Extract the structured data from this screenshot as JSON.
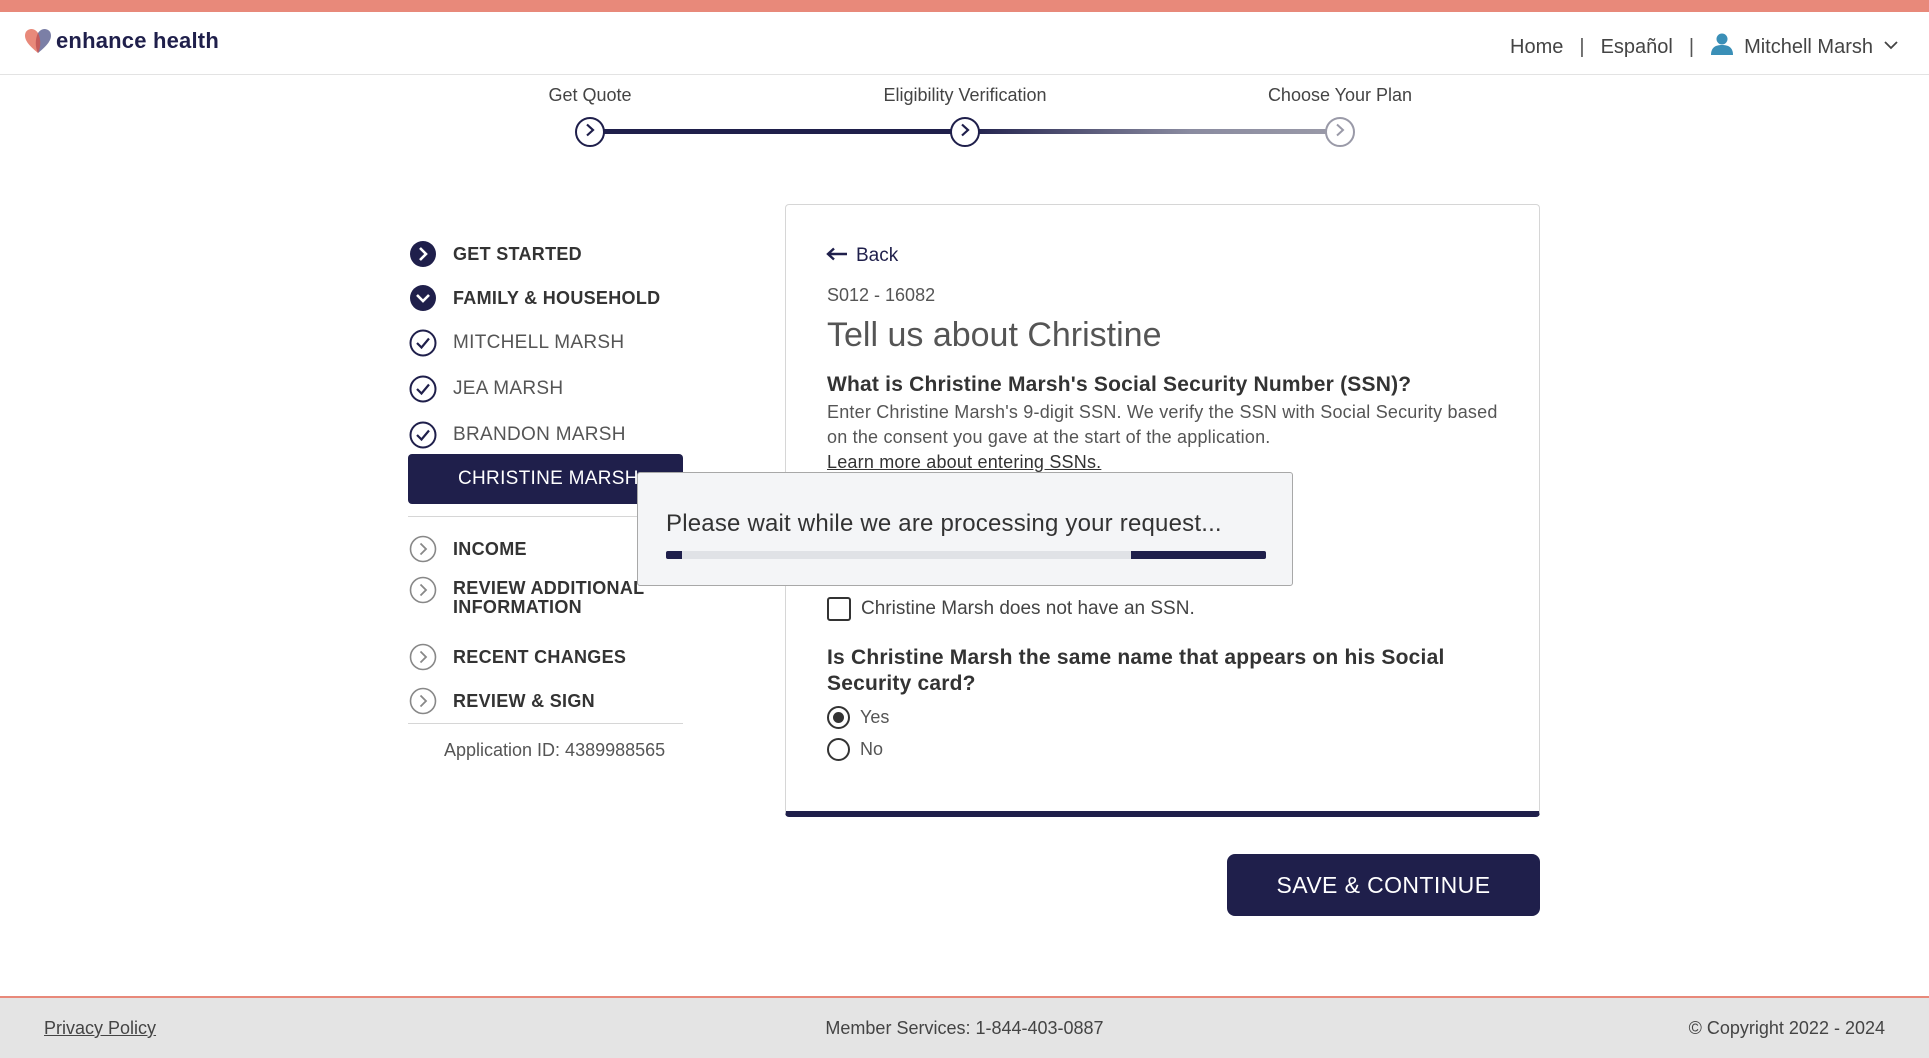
{
  "header": {
    "brand": "enhance health",
    "nav_home": "Home",
    "nav_sep": "|",
    "nav_lang": "Español",
    "user_name": "Mitchell Marsh"
  },
  "stepper": {
    "steps": [
      {
        "label": "Get Quote",
        "state": "complete"
      },
      {
        "label": "Eligibility Verification",
        "state": "current"
      },
      {
        "label": "Choose Your Plan",
        "state": "upcoming"
      }
    ]
  },
  "sidebar": {
    "items": [
      {
        "label": "GET STARTED",
        "icon": "chevron-right-filled-icon"
      },
      {
        "label": "FAMILY & HOUSEHOLD",
        "icon": "chevron-down-filled-icon"
      },
      {
        "label": "MITCHELL MARSH",
        "icon": "check-circle-icon"
      },
      {
        "label": "JEA MARSH",
        "icon": "check-circle-icon"
      },
      {
        "label": "BRANDON MARSH",
        "icon": "check-circle-icon"
      },
      {
        "label": "CHRISTINE MARSH",
        "icon": "active"
      },
      {
        "label": "INCOME",
        "icon": "chevron-right-outline-icon"
      },
      {
        "label": "REVIEW ADDITIONAL INFORMATION",
        "icon": "chevron-right-outline-icon"
      },
      {
        "label": "RECENT CHANGES",
        "icon": "chevron-right-outline-icon"
      },
      {
        "label": "REVIEW & SIGN",
        "icon": "chevron-right-outline-icon"
      }
    ],
    "application_id": "Application ID: 4389988565"
  },
  "form": {
    "back_label": "Back",
    "form_id": "S012 - 16082",
    "title": "Tell us about Christine",
    "ssn_question": "What is Christine Marsh's Social Security Number (SSN)?",
    "ssn_help": "Enter Christine Marsh's 9-digit SSN. We verify the SSN with Social Security based on the consent you gave at the start of the application.",
    "ssn_link": "Learn more about entering SSNs.",
    "no_ssn_label": "Christine Marsh does not have an SSN.",
    "no_ssn_checked": false,
    "name_question": "Is Christine Marsh the same name that appears on his Social Security card?",
    "options": [
      {
        "label": "Yes",
        "selected": true
      },
      {
        "label": "No",
        "selected": false
      }
    ],
    "save_label": "SAVE & CONTINUE"
  },
  "modal": {
    "message": "Please wait while we are processing your request..."
  },
  "footer": {
    "privacy": "Privacy Policy",
    "member_services": "Member Services: 1-844-403-0887",
    "copyright": "© Copyright 2022 - 2024"
  },
  "colors": {
    "navy": "#1f1f4b",
    "accent": "#e8897a",
    "user_icon": "#3a8fb7"
  }
}
